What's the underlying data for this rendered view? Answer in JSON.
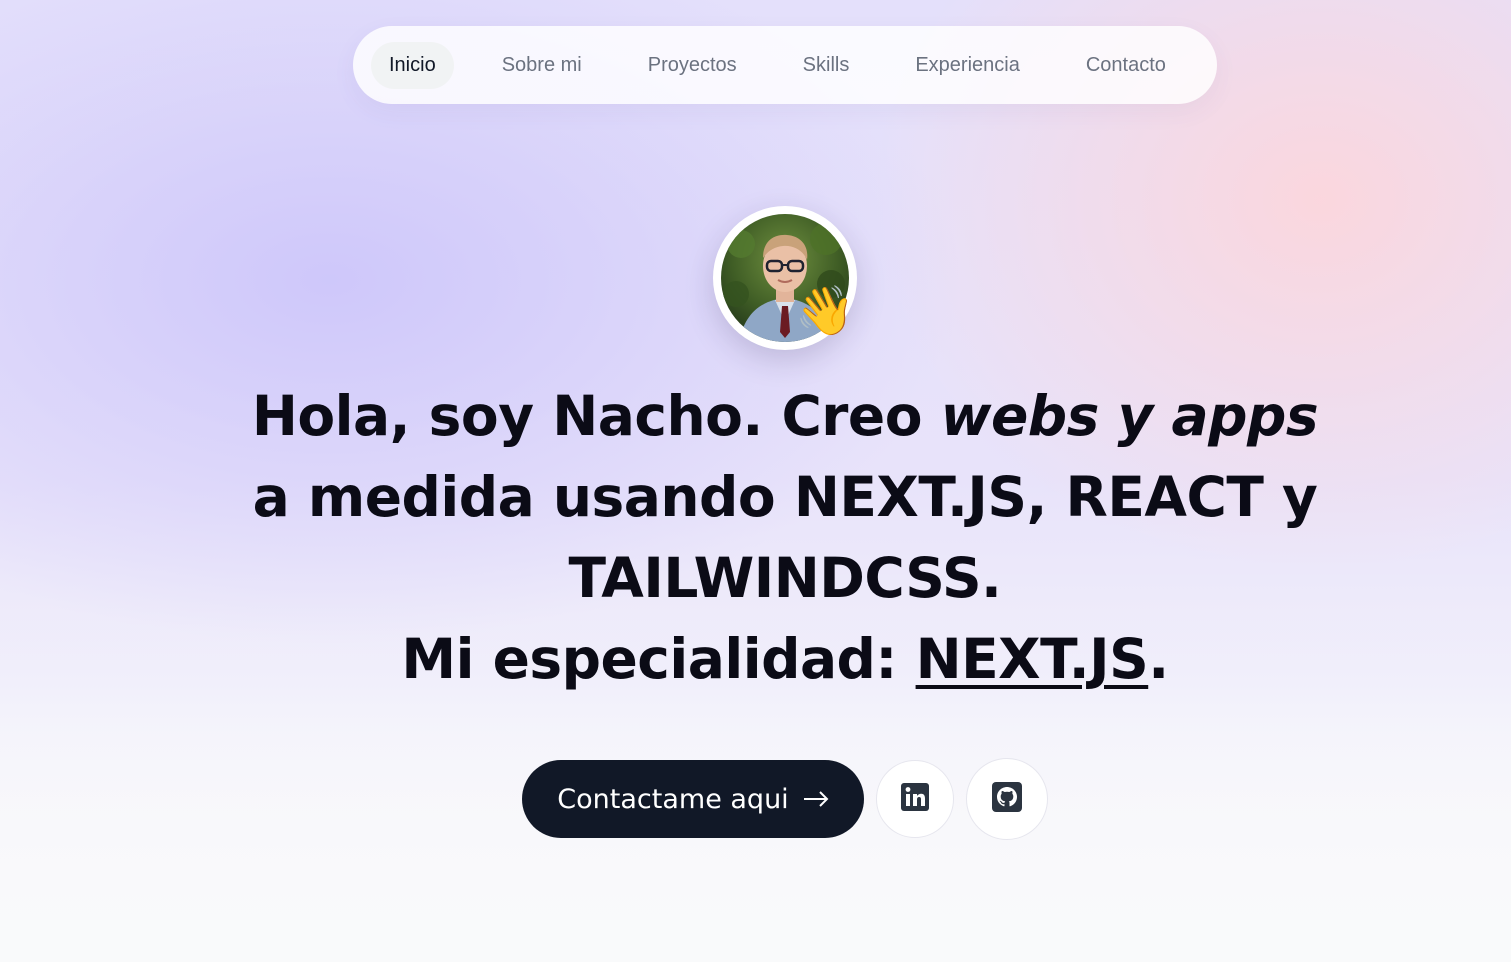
{
  "nav": {
    "items": [
      {
        "label": "Inicio",
        "active": true
      },
      {
        "label": "Sobre mi"
      },
      {
        "label": "Proyectos"
      },
      {
        "label": "Skills"
      },
      {
        "label": "Experiencia"
      },
      {
        "label": "Contacto"
      }
    ]
  },
  "hero": {
    "wave_emoji": "👋",
    "line1_pre": "Hola, soy ",
    "name": "Nacho",
    "line1_mid": ". Creo ",
    "italic": "webs y apps",
    "line1_post": " a medida usando NEXT.JS, REACT y TAILWINDCSS.",
    "line2_pre": "Mi especialidad: ",
    "specialty": "NEXT.JS",
    "line2_post": "."
  },
  "actions": {
    "contact_label": "Contactame aqui",
    "linkedin_icon": "linkedin-icon",
    "github_icon": "github-icon"
  },
  "colors": {
    "dark": "#111827",
    "nav_text": "#6b7280",
    "active_bg": "#f1f3f4"
  }
}
